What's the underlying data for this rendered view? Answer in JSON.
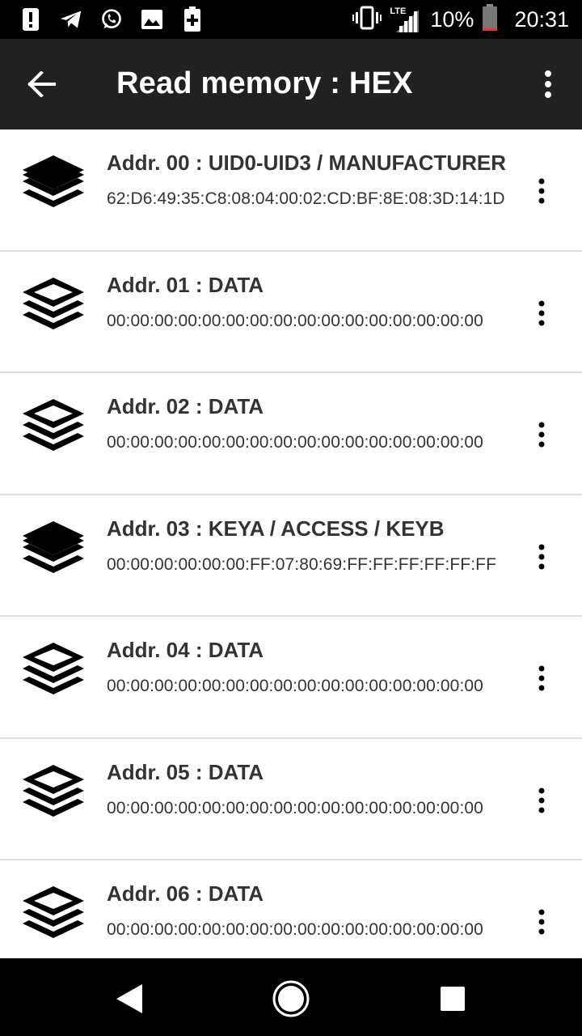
{
  "status_bar": {
    "icons_left": [
      "alert-icon",
      "telegram-icon",
      "whatsapp-icon",
      "image-icon",
      "battery-saver-icon"
    ],
    "icons_right": [
      "vibrate-icon",
      "lte-signal-icon",
      "battery-icon"
    ],
    "network_label": "LTE",
    "battery_percent": "10%",
    "time": "20:31",
    "battery_level": 0.1,
    "battery_level_color": "#e53935"
  },
  "app_bar": {
    "title": "Read memory : HEX",
    "back_icon": "arrow-left-icon",
    "menu_icon": "more-vert-icon",
    "background": "#212121"
  },
  "rows": [
    {
      "title": "Addr. 00 : UID0-UID3 / MANUFACTURER",
      "value": "62:D6:49:35:C8:08:04:00:02:CD:BF:8E:08:3D:14:1D",
      "icon": "layers-filled-icon"
    },
    {
      "title": "Addr. 01 : DATA",
      "value": "00:00:00:00:00:00:00:00:00:00:00:00:00:00:00:00",
      "icon": "layers-outline-icon"
    },
    {
      "title": "Addr. 02 : DATA",
      "value": "00:00:00:00:00:00:00:00:00:00:00:00:00:00:00:00",
      "icon": "layers-outline-icon"
    },
    {
      "title": "Addr. 03 : KEYA / ACCESS / KEYB",
      "value": "00:00:00:00:00:00:FF:07:80:69:FF:FF:FF:FF:FF:FF",
      "icon": "layers-filled-icon"
    },
    {
      "title": "Addr. 04 : DATA",
      "value": "00:00:00:00:00:00:00:00:00:00:00:00:00:00:00:00",
      "icon": "layers-outline-icon"
    },
    {
      "title": "Addr. 05 : DATA",
      "value": "00:00:00:00:00:00:00:00:00:00:00:00:00:00:00:00",
      "icon": "layers-outline-icon"
    },
    {
      "title": "Addr. 06 : DATA",
      "value": "00:00:00:00:00:00:00:00:00:00:00:00:00:00:00:00",
      "icon": "layers-outline-icon"
    }
  ],
  "nav_bar": {
    "buttons": [
      "back-triangle-icon",
      "home-circle-icon",
      "recents-square-icon"
    ]
  }
}
